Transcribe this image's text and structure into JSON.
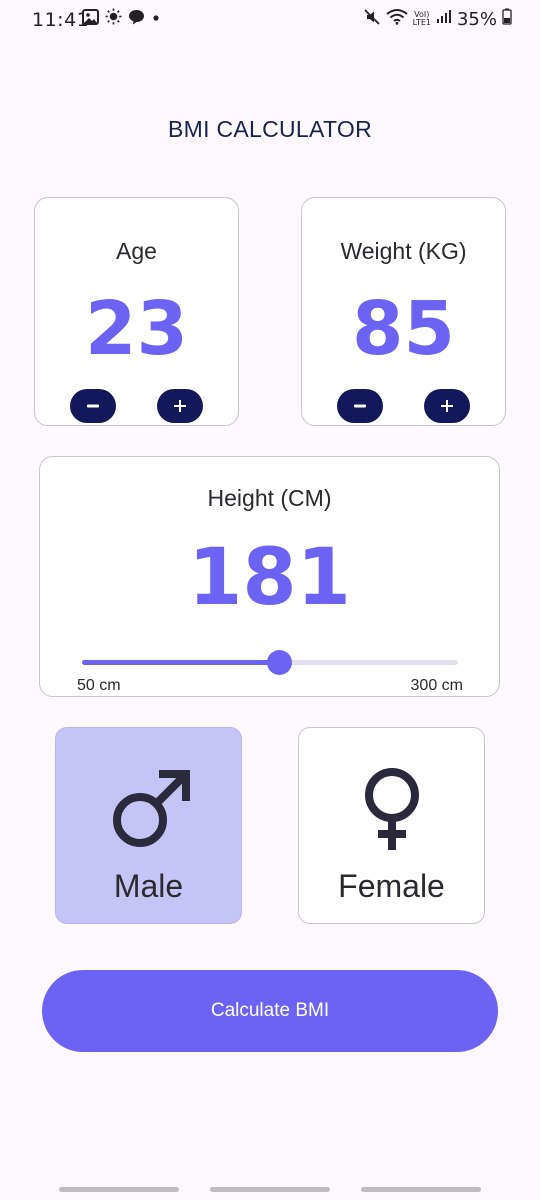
{
  "status_bar": {
    "time": "11:41",
    "network_label": "LTE1",
    "volte_label": "VoI)",
    "battery": "35%",
    "left_icons": [
      "gallery-icon",
      "weather-sun-icon",
      "chat-bubble-icon",
      "dot-icon"
    ],
    "right_icons": [
      "mute-icon",
      "wifi-icon",
      "signal-icon",
      "battery-icon"
    ]
  },
  "app": {
    "title": "BMI CALCULATOR",
    "accent_color": "#6c63f5",
    "button_dark_color": "#12185a",
    "selected_card_color": "#c5c4f6"
  },
  "age": {
    "label": "Age",
    "value": "23"
  },
  "weight": {
    "label": "Weight (KG)",
    "value": "85"
  },
  "height": {
    "label": "Height (CM)",
    "value": "181",
    "min_label": "50 cm",
    "max_label": "300 cm",
    "min": 50,
    "max": 300,
    "current": 181
  },
  "gender": {
    "male_label": "Male",
    "female_label": "Female",
    "selected": "male"
  },
  "calculate": {
    "label": "Calculate BMI"
  }
}
